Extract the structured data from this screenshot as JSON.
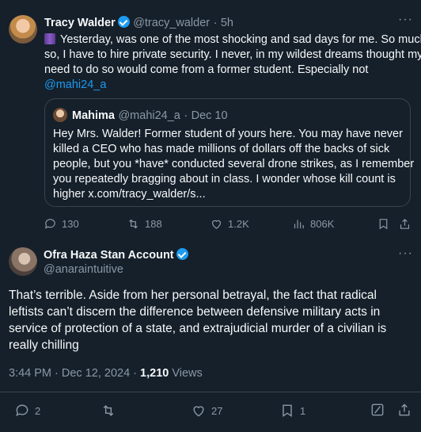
{
  "tweet1": {
    "author_name": "Tracy Walder",
    "handle": "@tracy_walder",
    "time": "5h",
    "text_line1": "Yesterday, was one of the most shocking and sad days for me.  So much",
    "text_line2": "so, I have to hire private security.  I never, in my wildest dreams thought my",
    "text_line3": "need to do so would come from a former student. Especially not",
    "mention": "@mahi24_a",
    "quote": {
      "author_name": "Mahima",
      "handle": "@mahi24_a",
      "date": "Dec 10",
      "line1": "Hey Mrs. Walder! Former student of yours here. You may have never",
      "line2": "killed a CEO who has made millions of dollars off the backs of sick",
      "line3": "people, but you *have* conducted several drone strikes, as I remember",
      "line4": "you repeatedly bragging about in class. I wonder whose kill count is",
      "line5": "higher x.com/tracy_walder/s..."
    },
    "actions": {
      "replies": "130",
      "reposts": "188",
      "likes": "1.2K",
      "views": "806K"
    }
  },
  "tweet2": {
    "author_name": "Ofra Haza Stan Account",
    "handle": "@anaraintuitive",
    "line1": "That’s terrible.  Aside from her personal betrayal, the fact that radical",
    "line2": "leftists can’t discern the difference between defensive military acts in",
    "line3": "service of protection of a state, and extrajudicial murder of a civilian is",
    "line4": "really chilling",
    "timestamp": "3:44 PM · Dec 12, 2024 · ",
    "views_count": "1,210",
    "views_label": " Views",
    "actions": {
      "replies": "2",
      "likes": "27",
      "bookmarks": "1"
    }
  },
  "colors": {
    "background": "#15202b",
    "accent": "#1d9bf0",
    "muted": "#8b98a5"
  }
}
